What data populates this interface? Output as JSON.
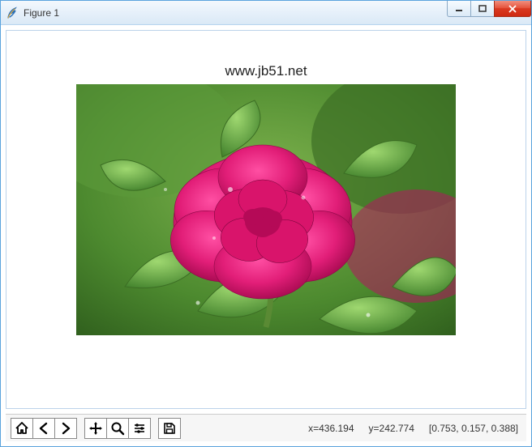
{
  "window": {
    "title": "Figure 1"
  },
  "win_buttons": {
    "minimize": "minimize",
    "maximize": "maximize",
    "close": "close"
  },
  "figure": {
    "title": "www.jb51.net",
    "image_alt": "pink peony flower with green leaves"
  },
  "toolbar": {
    "home": "Home",
    "back": "Back",
    "forward": "Forward",
    "pan": "Pan",
    "zoom": "Zoom",
    "config": "Configure subplots",
    "save": "Save"
  },
  "status": {
    "x_label": "x=436.194",
    "y_label": "y=242.774",
    "rgb": "[0.753, 0.157, 0.388]"
  }
}
